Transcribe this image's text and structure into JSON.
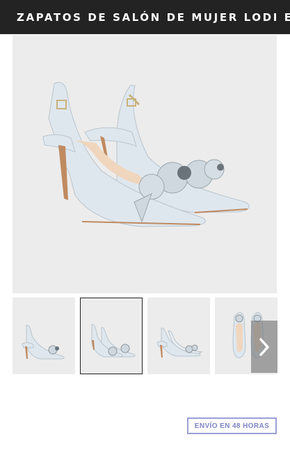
{
  "header": {
    "title": "ZAPATOS DE SALÓN DE MUJER LODI E..."
  },
  "gallery": {
    "main_image": "light-blue-leather-slingback-pumps-with-flower-appliqué",
    "thumbnails": [
      {
        "id": "thumb-1",
        "view": "side-view-single-shoe",
        "selected": false
      },
      {
        "id": "thumb-2",
        "view": "pair-three-quarter-view",
        "selected": true
      },
      {
        "id": "thumb-3",
        "view": "pair-side-view",
        "selected": false
      },
      {
        "id": "thumb-4",
        "view": "top-view-pair",
        "selected": false
      }
    ],
    "next_icon": "chevron-right-icon"
  },
  "badges": {
    "shipping": "ENVÍO EN 48 HORAS"
  },
  "colors": {
    "header_bg": "#232323",
    "image_bg": "#ececec",
    "shoe_leather": "#dfe7ee",
    "badge_border": "#9aa0d6",
    "badge_text": "#7d84c6"
  }
}
